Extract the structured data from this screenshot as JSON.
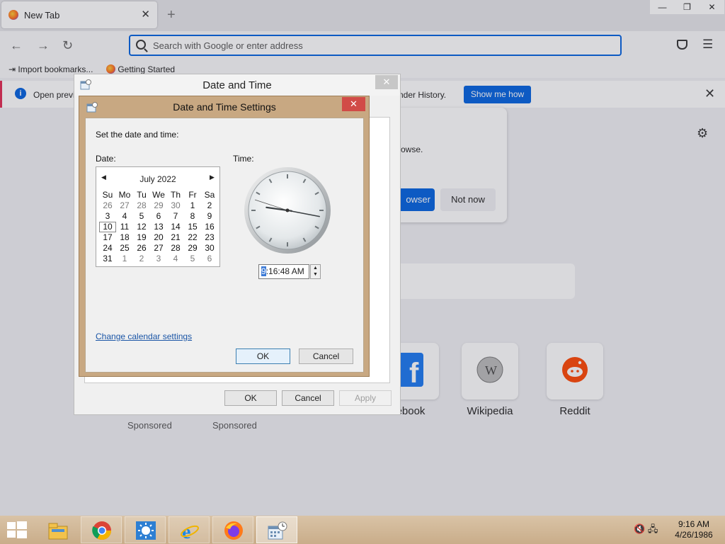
{
  "browser": {
    "tab_title": "New Tab",
    "new_tab_symbol": "+",
    "window_controls": {
      "minimize": "—",
      "restore": "❐",
      "close": "✕"
    },
    "url_placeholder": "Search with Google or enter address",
    "bookmarks": [
      "Import bookmarks...",
      "Getting Started"
    ],
    "notice": {
      "text_left": "Open previ",
      "text_right": "nder History.",
      "button": "Show me how"
    },
    "promo": {
      "text": "rowse.",
      "primary_button": "owser",
      "secondary_button": "Not now"
    },
    "shortcuts": [
      {
        "label": "ebook",
        "icon": "facebook-icon"
      },
      {
        "label": "Wikipedia",
        "icon": "wikipedia-icon"
      },
      {
        "label": "Reddit",
        "icon": "reddit-icon"
      }
    ],
    "sponsored": [
      "Sponsored",
      "Sponsored"
    ]
  },
  "date_time_dialog": {
    "title": "Date and Time",
    "close_symbol": "✕",
    "buttons": {
      "ok": "OK",
      "cancel": "Cancel",
      "apply": "Apply"
    }
  },
  "settings_dialog": {
    "title": "Date and Time Settings",
    "close_symbol": "✕",
    "instruction": "Set the date and time:",
    "date_label": "Date:",
    "time_label": "Time:",
    "calendar": {
      "month": "July 2022",
      "prev": "◀",
      "next": "▶",
      "weekdays": [
        "Su",
        "Mo",
        "Tu",
        "We",
        "Th",
        "Fr",
        "Sa"
      ],
      "weeks": [
        [
          "26",
          "27",
          "28",
          "29",
          "30",
          "1",
          "2"
        ],
        [
          "3",
          "4",
          "5",
          "6",
          "7",
          "8",
          "9"
        ],
        [
          "10",
          "11",
          "12",
          "13",
          "14",
          "15",
          "16"
        ],
        [
          "17",
          "18",
          "19",
          "20",
          "21",
          "22",
          "23"
        ],
        [
          "24",
          "25",
          "26",
          "27",
          "28",
          "29",
          "30"
        ],
        [
          "31",
          "1",
          "2",
          "3",
          "4",
          "5",
          "6"
        ]
      ],
      "selected_day": "10"
    },
    "time": {
      "hour_selected": "9",
      "rest": ":16:48 AM",
      "hour": 9,
      "minute": 16,
      "second": 48
    },
    "spin_up": "▲",
    "spin_down": "▼",
    "change_calendar_link": "Change calendar settings",
    "ok": "OK",
    "cancel": "Cancel"
  },
  "taskbar": {
    "apps": [
      "file-explorer-icon",
      "chrome-icon",
      "weather-icon",
      "internet-explorer-icon",
      "firefox-icon",
      "date-time-icon"
    ],
    "tray_time": "9:16 AM",
    "tray_date": "4/26/1986"
  }
}
